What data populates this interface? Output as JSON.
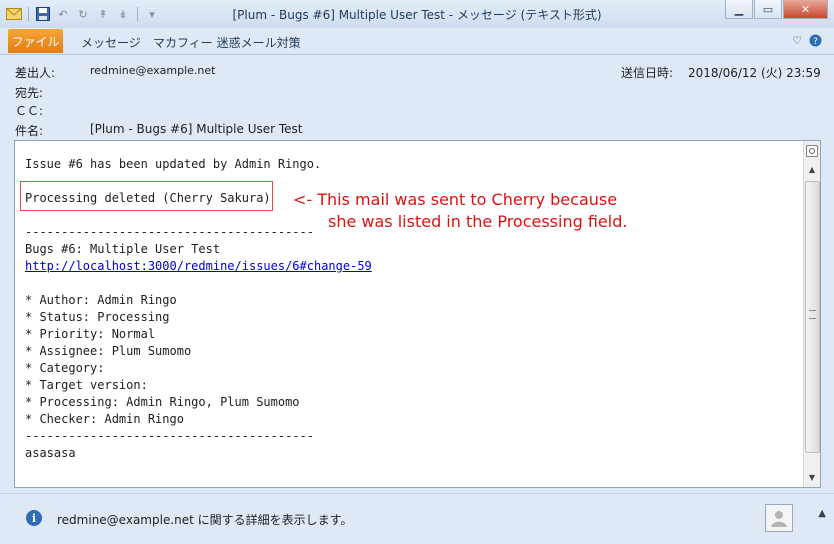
{
  "window": {
    "title": "[Plum - Bugs #6] Multiple User Test - メッセージ (テキスト形式)",
    "minimize_icon": "minimize-icon",
    "maximize_icon": "maximize-icon",
    "close_icon": "close-icon"
  },
  "ribbon": {
    "tabs": [
      "ファイル",
      "メッセージ",
      "マカフィー 迷惑メール対策"
    ],
    "help_icon": "help-icon",
    "collapse_icon": "chevron-up-icon"
  },
  "header": {
    "from_label": "差出人:",
    "from_value": "redmine@example.net",
    "to_label": "宛先:",
    "cc_label": "ＣＣ:",
    "subject_label": "件名:",
    "subject_value": "[Plum - Bugs #6] Multiple User Test",
    "sent_label": "送信日時:",
    "sent_value": "2018/06/12 (火) 23:59"
  },
  "body": {
    "line1": "Issue #6 has been updated by Admin Ringo.",
    "highlighted": "Processing deleted (Cherry Sakura)",
    "separator": "----------------------------------------",
    "issue_title": "Bugs #6: Multiple User Test",
    "issue_link": "http://localhost:3000/redmine/issues/6#change-59",
    "fields": [
      "* Author: Admin Ringo",
      "* Status: Processing",
      "* Priority: Normal",
      "* Assignee: Plum Sumomo",
      "* Category:",
      "* Target version:",
      "* Processing: Admin Ringo, Plum Sumomo",
      "* Checker: Admin Ringo"
    ],
    "footer_separator": "----------------------------------------",
    "last_line": "asasasa"
  },
  "annotation": {
    "line1": "<- This mail was sent to Cherry because",
    "line2": "she was listed in the Processing field.",
    "color": "#e01010"
  },
  "statusbar": {
    "text": "redmine@example.net に関する詳細を表示します。"
  }
}
